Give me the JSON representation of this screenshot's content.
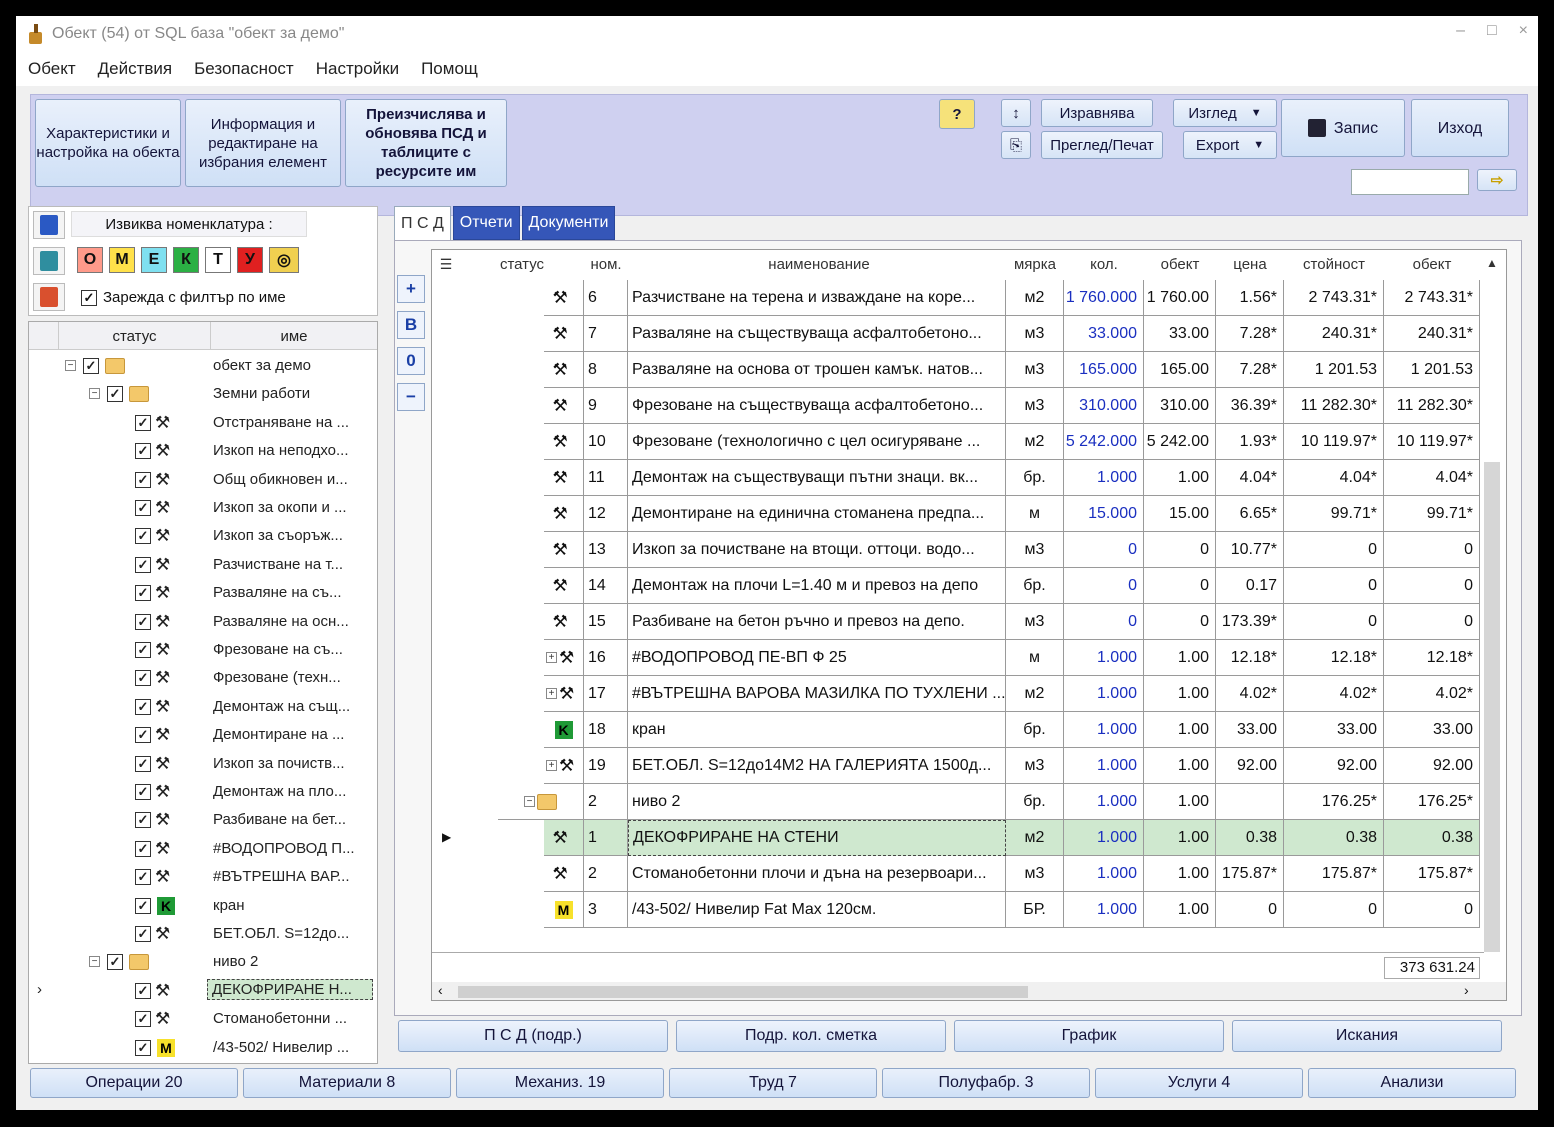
{
  "window": {
    "title": "Обект (54) от SQL база \"обект за демо\"",
    "controls": [
      "–",
      "□",
      "×"
    ]
  },
  "menu": [
    "Обект",
    "Действия",
    "Безопасност",
    "Настройки",
    "Помощ"
  ],
  "toolbar": {
    "btn1": "Характеристики и настройка на обекта",
    "btn2": "Информация и редактиране на избрания елемент",
    "btn3": "Преизчислява и обновява ПСД и таблиците с ресурсите им",
    "help": "?",
    "align": "Изравнява",
    "preview": "Преглед/Печат",
    "view": "Изглед",
    "export": "Export",
    "save": "Запис",
    "exit": "Изход",
    "search_value": "",
    "go": "⇨"
  },
  "nomenclature": {
    "label": "Извиква номенклатура :",
    "codes": [
      "О",
      "М",
      "Е",
      "К",
      "Т",
      "У"
    ],
    "filter_label": "Зарежда с филтър по име",
    "filter_checked": true
  },
  "tree": {
    "headers": [
      "статус",
      "име"
    ],
    "rows": [
      {
        "level": 0,
        "type": "root",
        "name": "обект за демо"
      },
      {
        "level": 1,
        "type": "folder",
        "name": "Земни работи"
      },
      {
        "level": 2,
        "type": "tool",
        "name": "Отстраняване на ..."
      },
      {
        "level": 2,
        "type": "tool",
        "name": "Изкоп на неподхо..."
      },
      {
        "level": 2,
        "type": "tool",
        "name": "Общ обикновен и..."
      },
      {
        "level": 2,
        "type": "tool",
        "name": "Изкоп за окопи и ..."
      },
      {
        "level": 2,
        "type": "tool",
        "name": "Изкоп за съоръж..."
      },
      {
        "level": 2,
        "type": "tool",
        "name": "Разчистване на т..."
      },
      {
        "level": 2,
        "type": "tool",
        "name": "Разваляне на съ..."
      },
      {
        "level": 2,
        "type": "tool",
        "name": "Разваляне на осн..."
      },
      {
        "level": 2,
        "type": "tool",
        "name": "Фрезоване на съ..."
      },
      {
        "level": 2,
        "type": "tool",
        "name": "Фрезоване (техн..."
      },
      {
        "level": 2,
        "type": "tool",
        "name": "Демонтаж на същ..."
      },
      {
        "level": 2,
        "type": "tool",
        "name": "Демонтиране на ..."
      },
      {
        "level": 2,
        "type": "tool",
        "name": "Изкоп за почиств..."
      },
      {
        "level": 2,
        "type": "tool",
        "name": "Демонтаж на пло..."
      },
      {
        "level": 2,
        "type": "tool",
        "name": "Разбиване на бет..."
      },
      {
        "level": 2,
        "type": "tool",
        "name": "#ВОДОПРОВОД П..."
      },
      {
        "level": 2,
        "type": "tool",
        "name": "#ВЪТРЕШНА ВАР..."
      },
      {
        "level": 2,
        "type": "k",
        "name": "кран"
      },
      {
        "level": 2,
        "type": "tool",
        "name": "БЕТ.ОБЛ. S=12до..."
      },
      {
        "level": 1,
        "type": "folder",
        "name": "ниво 2"
      },
      {
        "level": 2,
        "type": "tool",
        "name": "ДЕКОФРИРАНЕ Н...",
        "selected": true
      },
      {
        "level": 2,
        "type": "tool",
        "name": "Стоманобетонни ..."
      },
      {
        "level": 2,
        "type": "m",
        "name": "/43-502/ Нивелир ..."
      }
    ]
  },
  "tabs": [
    "П С Д",
    "Отчети",
    "Документи"
  ],
  "side_buttons": [
    "+",
    "B",
    "0",
    "−"
  ],
  "grid": {
    "headers": [
      "статус",
      "ном.",
      "наименование",
      "мярка",
      "кол.",
      "обект",
      "цена",
      "стойност",
      "обект"
    ],
    "rows": [
      {
        "icon": "tool",
        "exp": false,
        "no": "6",
        "name": "Разчистване на терена и изваждане на коре...",
        "unit": "м2",
        "qty": "1 760.000",
        "obj": "1 760.00",
        "price": "1.56*",
        "value": "2 743.31*",
        "obj2": "2 743.31*"
      },
      {
        "icon": "tool",
        "exp": false,
        "no": "7",
        "name": "Разваляне на съществуваща асфалтобетоно...",
        "unit": "м3",
        "qty": "33.000",
        "obj": "33.00",
        "price": "7.28*",
        "value": "240.31*",
        "obj2": "240.31*"
      },
      {
        "icon": "tool",
        "exp": false,
        "no": "8",
        "name": "Разваляне на основа от трошен камък. натов...",
        "unit": "м3",
        "qty": "165.000",
        "obj": "165.00",
        "price": "7.28*",
        "value": "1 201.53",
        "obj2": "1 201.53"
      },
      {
        "icon": "tool",
        "exp": false,
        "no": "9",
        "name": "Фрезоване на съществуваща асфалтобетоно...",
        "unit": "м3",
        "qty": "310.000",
        "obj": "310.00",
        "price": "36.39*",
        "value": "11 282.30*",
        "obj2": "11 282.30*"
      },
      {
        "icon": "tool",
        "exp": false,
        "no": "10",
        "name": "Фрезоване (технологично с цел осигуряване ...",
        "unit": "м2",
        "qty": "5 242.000",
        "obj": "5 242.00",
        "price": "1.93*",
        "value": "10 119.97*",
        "obj2": "10 119.97*"
      },
      {
        "icon": "tool",
        "exp": false,
        "no": "11",
        "name": "Демонтаж на съществуващи пътни знаци. вк...",
        "unit": "бр.",
        "qty": "1.000",
        "obj": "1.00",
        "price": "4.04*",
        "value": "4.04*",
        "obj2": "4.04*"
      },
      {
        "icon": "tool",
        "exp": false,
        "no": "12",
        "name": "Демонтиране на единична стоманена предпа...",
        "unit": "м",
        "qty": "15.000",
        "obj": "15.00",
        "price": "6.65*",
        "value": "99.71*",
        "obj2": "99.71*"
      },
      {
        "icon": "tool",
        "exp": false,
        "no": "13",
        "name": "Изкоп за почистване на втощи. оттоци. водо...",
        "unit": "м3",
        "qty": "0",
        "obj": "0",
        "price": "10.77*",
        "value": "0",
        "obj2": "0"
      },
      {
        "icon": "tool",
        "exp": false,
        "no": "14",
        "name": "Демонтаж на плочи L=1.40 м и превоз на депо",
        "unit": "бр.",
        "qty": "0",
        "obj": "0",
        "price": "0.17",
        "value": "0",
        "obj2": "0"
      },
      {
        "icon": "tool",
        "exp": false,
        "no": "15",
        "name": "Разбиване на бетон ръчно и превоз на депо.",
        "unit": "м3",
        "qty": "0",
        "obj": "0",
        "price": "173.39*",
        "value": "0",
        "obj2": "0"
      },
      {
        "icon": "tool",
        "exp": true,
        "no": "16",
        "name": "#ВОДОПРОВОД ПЕ-ВП Ф 25",
        "unit": "м",
        "qty": "1.000",
        "obj": "1.00",
        "price": "12.18*",
        "value": "12.18*",
        "obj2": "12.18*"
      },
      {
        "icon": "tool",
        "exp": true,
        "no": "17",
        "name": "#ВЪТРЕШНА ВАРОВА МАЗИЛКА ПО ТУХЛЕНИ ...",
        "unit": "м2",
        "qty": "1.000",
        "obj": "1.00",
        "price": "4.02*",
        "value": "4.02*",
        "obj2": "4.02*"
      },
      {
        "icon": "k",
        "exp": false,
        "no": "18",
        "name": "кран",
        "unit": "бр.",
        "qty": "1.000",
        "obj": "1.00",
        "price": "33.00",
        "value": "33.00",
        "obj2": "33.00"
      },
      {
        "icon": "tool",
        "exp": true,
        "no": "19",
        "name": "БЕТ.ОБЛ. S=12до14M2 НА ГАЛЕРИЯТА 1500д...",
        "unit": "м3",
        "qty": "1.000",
        "obj": "1.00",
        "price": "92.00",
        "value": "92.00",
        "obj2": "92.00"
      },
      {
        "icon": "folder",
        "exp": true,
        "no": "2",
        "name": "ниво 2",
        "unit": "бр.",
        "qty": "1.000",
        "obj": "1.00",
        "price": "",
        "value": "176.25*",
        "obj2": "176.25*"
      },
      {
        "icon": "tool",
        "exp": false,
        "no": "1",
        "name": "ДЕКОФРИРАНЕ НА СТЕНИ",
        "unit": "м2",
        "qty": "1.000",
        "obj": "1.00",
        "price": "0.38",
        "value": "0.38",
        "obj2": "0.38",
        "selected": true
      },
      {
        "icon": "tool",
        "exp": false,
        "no": "2",
        "name": "Стоманобетонни плочи и дъна на резервоари...",
        "unit": "м3",
        "qty": "1.000",
        "obj": "1.00",
        "price": "175.87*",
        "value": "175.87*",
        "obj2": "175.87*"
      },
      {
        "icon": "m",
        "exp": false,
        "no": "3",
        "name": "/43-502/ Нивелир Fat Max 120см.",
        "unit": "БР.",
        "qty": "1.000",
        "obj": "1.00",
        "price": "0",
        "value": "0",
        "obj2": "0"
      }
    ],
    "total": "373 631.24"
  },
  "bottom_buttons": [
    "П С Д (подр.)",
    "Подр. кол. сметка",
    "График",
    "Искания"
  ],
  "status_buttons": [
    "Операции 20",
    "Материали 8",
    "Механиз. 19",
    "Труд 7",
    "Полуфабр. 3",
    "Услуги 4",
    "Анализи"
  ]
}
